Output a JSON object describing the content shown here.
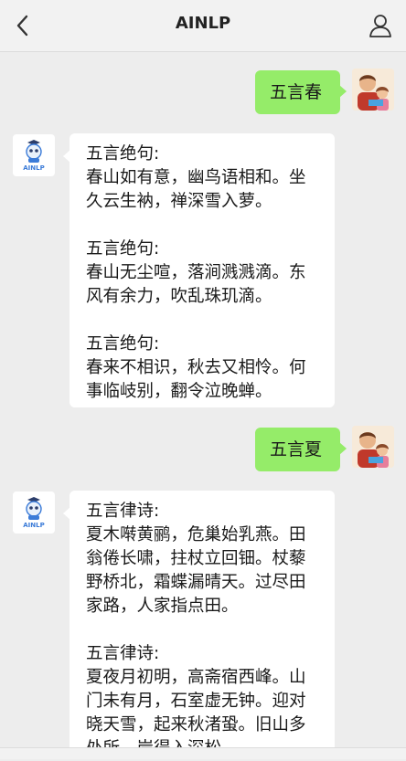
{
  "header": {
    "title": "AINLP"
  },
  "icons": {
    "back": "back-arrow-icon",
    "profile": "user-profile-icon"
  },
  "bot": {
    "brand": "AINLP"
  },
  "conversation": [
    {
      "from": "user",
      "text": "五言春"
    },
    {
      "from": "bot",
      "blocks": [
        [
          "五言绝句:",
          "春山如有意，幽鸟语相和。坐",
          "久云生衲，禅深雪入萝。"
        ],
        [
          "五言绝句:",
          "春山无尘喧，落涧溅溅滴。东",
          "风有余力，吹乱珠玑滴。"
        ],
        [
          "五言绝句:",
          "春来不相识，秋去又相怜。何",
          "事临岐别，翻令泣晚蝉。"
        ]
      ]
    },
    {
      "from": "user",
      "text": "五言夏"
    },
    {
      "from": "bot",
      "blocks": [
        [
          "五言律诗:",
          "夏木啭黄鹂，危巢始乳燕。田",
          "翁倦长啸，拄杖立回钿。杖藜",
          "野桥北，霜蝶漏晴天。过尽田",
          "家路，人家指点田。"
        ],
        [
          "五言律诗:",
          "夏夜月初明，高斋宿西峰。山",
          "门未有月，石室虚无钟。迎对",
          "晓天雪，起来秋渚蛩。旧山多",
          "处所，岸得入深松。"
        ]
      ]
    }
  ],
  "colors": {
    "user_bubble": "#95ec69",
    "bot_bubble": "#ffffff",
    "background": "#ededed"
  }
}
